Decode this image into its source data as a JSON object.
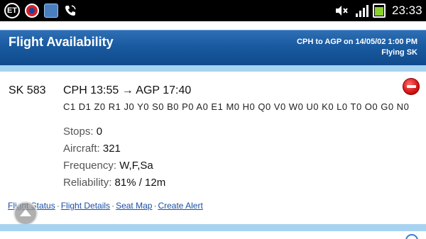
{
  "status_bar": {
    "et_label": "ET",
    "time": "23:33",
    "icons": [
      "et-badge-icon",
      "record-icon",
      "calendar-app-icon",
      "phone-icon",
      "mute-icon",
      "signal-icon",
      "battery-icon"
    ],
    "battery_color": "#8bd12c"
  },
  "header": {
    "title": "Flight Availability",
    "route_info": "CPH to AGP on 14/05/02 1:00 PM",
    "carrier": "Flying SK",
    "bar_color": "#1a5aa0",
    "separator_color": "#a7d3f0"
  },
  "flight": {
    "number": "SK 583",
    "route": "CPH 13:55 → AGP 17:40",
    "booking_classes": "C1 D1 Z0 R1 J0 Y0 S0 B0 P0 A0 E1 M0 H0 Q0 V0 W0 U0 K0 L0 T0 O0 G0 N0",
    "details": {
      "stops_label": "Stops:",
      "stops_value": "0",
      "aircraft_label": "Aircraft:",
      "aircraft_value": "321",
      "frequency_label": "Frequency:",
      "frequency_value": "W,F,Sa",
      "reliability_label": "Reliability:",
      "reliability_value": "81% / 12m"
    },
    "links": {
      "flight_status": "Flight Status",
      "flight_details": "Flight Details",
      "seat_map": "Seat Map",
      "create_alert": "Create Alert",
      "separator": "·"
    }
  }
}
